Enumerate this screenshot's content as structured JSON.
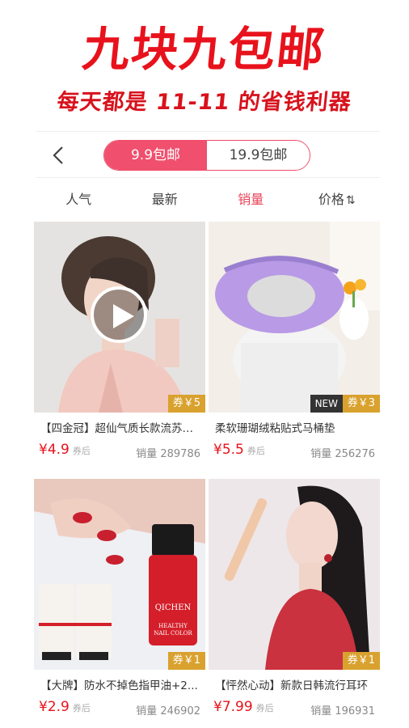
{
  "banner": {
    "title": "九块九包邮",
    "subtitle": "每天都是 11-11 的省钱利器"
  },
  "switch": {
    "back_icon": "chevron-left-icon",
    "options": [
      "9.9包邮",
      "19.9包邮"
    ],
    "selected": "9.9包邮"
  },
  "sort": {
    "items": [
      "人气",
      "最新",
      "销量",
      "价格"
    ],
    "active": "销量",
    "price_sort_icon": "⇅"
  },
  "colors": {
    "accent": "#f0506e",
    "price": "#e8121c",
    "coupon": "#d9a12e"
  },
  "products": [
    {
      "title": "【四金冠】超仙气质长款流苏耳...",
      "price": "¥4.9",
      "price_suffix": "券后",
      "sales": "销量 289786",
      "coupon": "券￥5",
      "has_video": true,
      "new_tag": ""
    },
    {
      "title": "柔软珊瑚绒粘贴式马桶垫",
      "price": "¥5.5",
      "price_suffix": "券后",
      "sales": "销量 256276",
      "coupon": "券￥3",
      "has_video": false,
      "new_tag": "NEW"
    },
    {
      "title": "【大牌】防水不掉色指甲油+2...",
      "price": "¥2.9",
      "price_suffix": "券后",
      "sales": "销量 246902",
      "coupon": "券￥1",
      "has_video": false,
      "new_tag": "",
      "image_text": "QICHEN",
      "image_text_2": "HEALTHY NAIL COLOR"
    },
    {
      "title": "【怦然心动】新款日韩流行耳环",
      "price": "¥7.99",
      "price_suffix": "券后",
      "sales": "销量 196931",
      "coupon": "券￥1",
      "has_video": false,
      "new_tag": ""
    }
  ]
}
